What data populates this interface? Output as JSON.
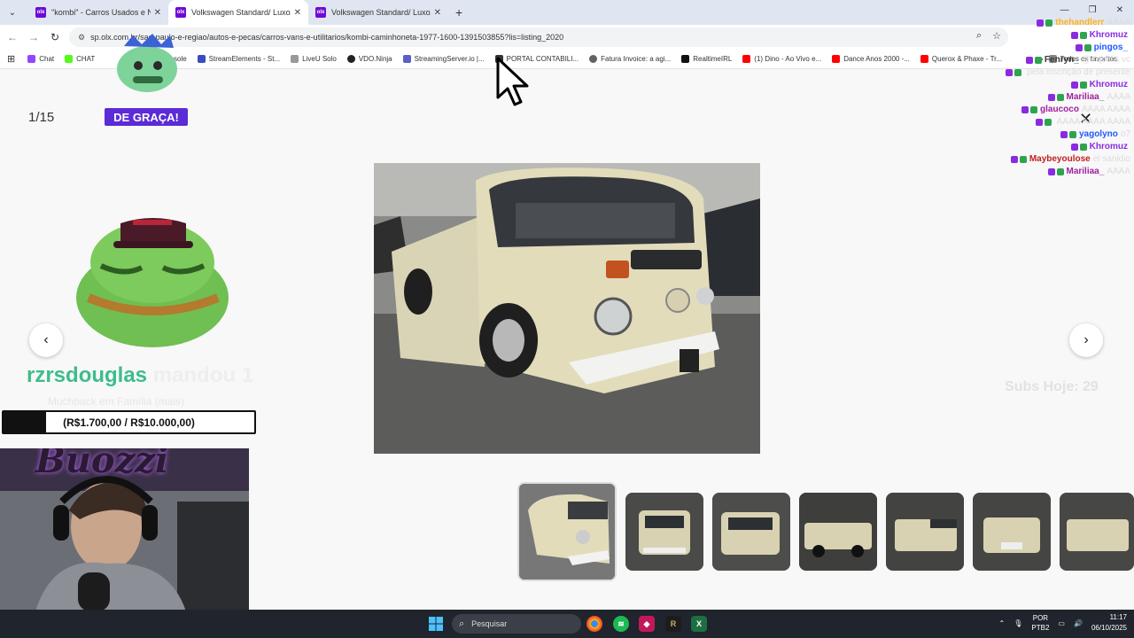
{
  "browser": {
    "tabs": [
      {
        "title": "\"kombi\" - Carros Usados e Novos",
        "active": false
      },
      {
        "title": "Volkswagen Standard/ Luxo/ Super",
        "active": true
      },
      {
        "title": "Volkswagen Standard/ Luxo/ Super",
        "active": false
      }
    ],
    "new_tab": "+",
    "url": "sp.olx.com.br/sao-paulo-e-regiao/autos-e-pecas/carros-vans-e-utilitarios/kombi-caminhoneta-1977-1600-1391503855?lis=listing_2020",
    "bookmarks": [
      {
        "label": "Chat",
        "color": "#9146ff"
      },
      {
        "label": "CHAT",
        "color": "#53fc18"
      },
      {
        "label": "",
        "color": "#444444"
      },
      {
        "label": "Console",
        "color": "#666666"
      },
      {
        "label": "StreamElements - St...",
        "color": "#3b4cc0"
      },
      {
        "label": "LiveU Solo",
        "color": "#999999"
      },
      {
        "label": "VDO.Ninja",
        "color": "#222222"
      },
      {
        "label": "StreamingServer.io |...",
        "color": "#5b5fc7"
      },
      {
        "label": "PORTAL CONTABILI...",
        "color": "#333333"
      },
      {
        "label": "Fatura Invoice: a agi...",
        "color": "#5f6368"
      },
      {
        "label": "RealtimeIRL",
        "color": "#111111"
      },
      {
        "label": "(1) Dino - Ao Vivo e...",
        "color": "#ff0000"
      },
      {
        "label": "Dance Anos 2000 -...",
        "color": "#ff0000"
      },
      {
        "label": "Querox & Phaxe - Tr...",
        "color": "#ff0000"
      }
    ],
    "all_bookmarks": "Todos os favoritos"
  },
  "gallery": {
    "counter": "1/15",
    "prev_icon": "‹",
    "next_icon": "›",
    "close_icon": "✕",
    "thumbnail_count": 7
  },
  "overlay": {
    "promo_label": "DE GRAÇA!",
    "donation_user": "rzrsdouglas",
    "donation_rest": " mandou 1",
    "donation_sub": "Muchback em Família (mais)",
    "goal_text": "(R$1.700,00 / R$10.000,00)",
    "goal_progress": 0.17,
    "webcam_sign": "Buozzi",
    "subs_today": "Subs Hoje: 29"
  },
  "chat": [
    {
      "nick": "thehandlerr",
      "msg": "AAAA",
      "color": "#ffb31a"
    },
    {
      "nick": "Khromuz",
      "msg": "",
      "color": "#8a2be2"
    },
    {
      "nick": "pingos_",
      "msg": "",
      "color": "#1e5aff"
    },
    {
      "nick": "Fenryn_",
      "msg": "@Xqcelis vc",
      "color": "#3a3a3a"
    },
    {
      "nick": "",
      "msg": "pela inscrição de presente",
      "color": "#dcdcdc"
    },
    {
      "nick": "Khromuz",
      "msg": "",
      "color": "#8a2be2"
    },
    {
      "nick": "Mariliaa_",
      "msg": "AAAA",
      "color": "#a020a0"
    },
    {
      "nick": "glaucoco",
      "msg": "AAAA AAAA",
      "color": "#a020a0"
    },
    {
      "nick": "",
      "msg": "AAAA AAAA AAAA",
      "color": "#dcdcdc"
    },
    {
      "nick": "yagolyno",
      "msg": "o7",
      "color": "#1e5aff"
    },
    {
      "nick": "Khromuz",
      "msg": "",
      "color": "#8a2be2"
    },
    {
      "nick": "Maybeyoulose",
      "msg": "el sanidio",
      "color": "#c02020"
    },
    {
      "nick": "Mariliaa_",
      "msg": "AAAA",
      "color": "#a020a0"
    }
  ],
  "taskbar": {
    "search_placeholder": "Pesquisar",
    "lang_top": "POR",
    "lang_bottom": "PTB2",
    "time": "11:17",
    "date": "06/10/2025"
  }
}
